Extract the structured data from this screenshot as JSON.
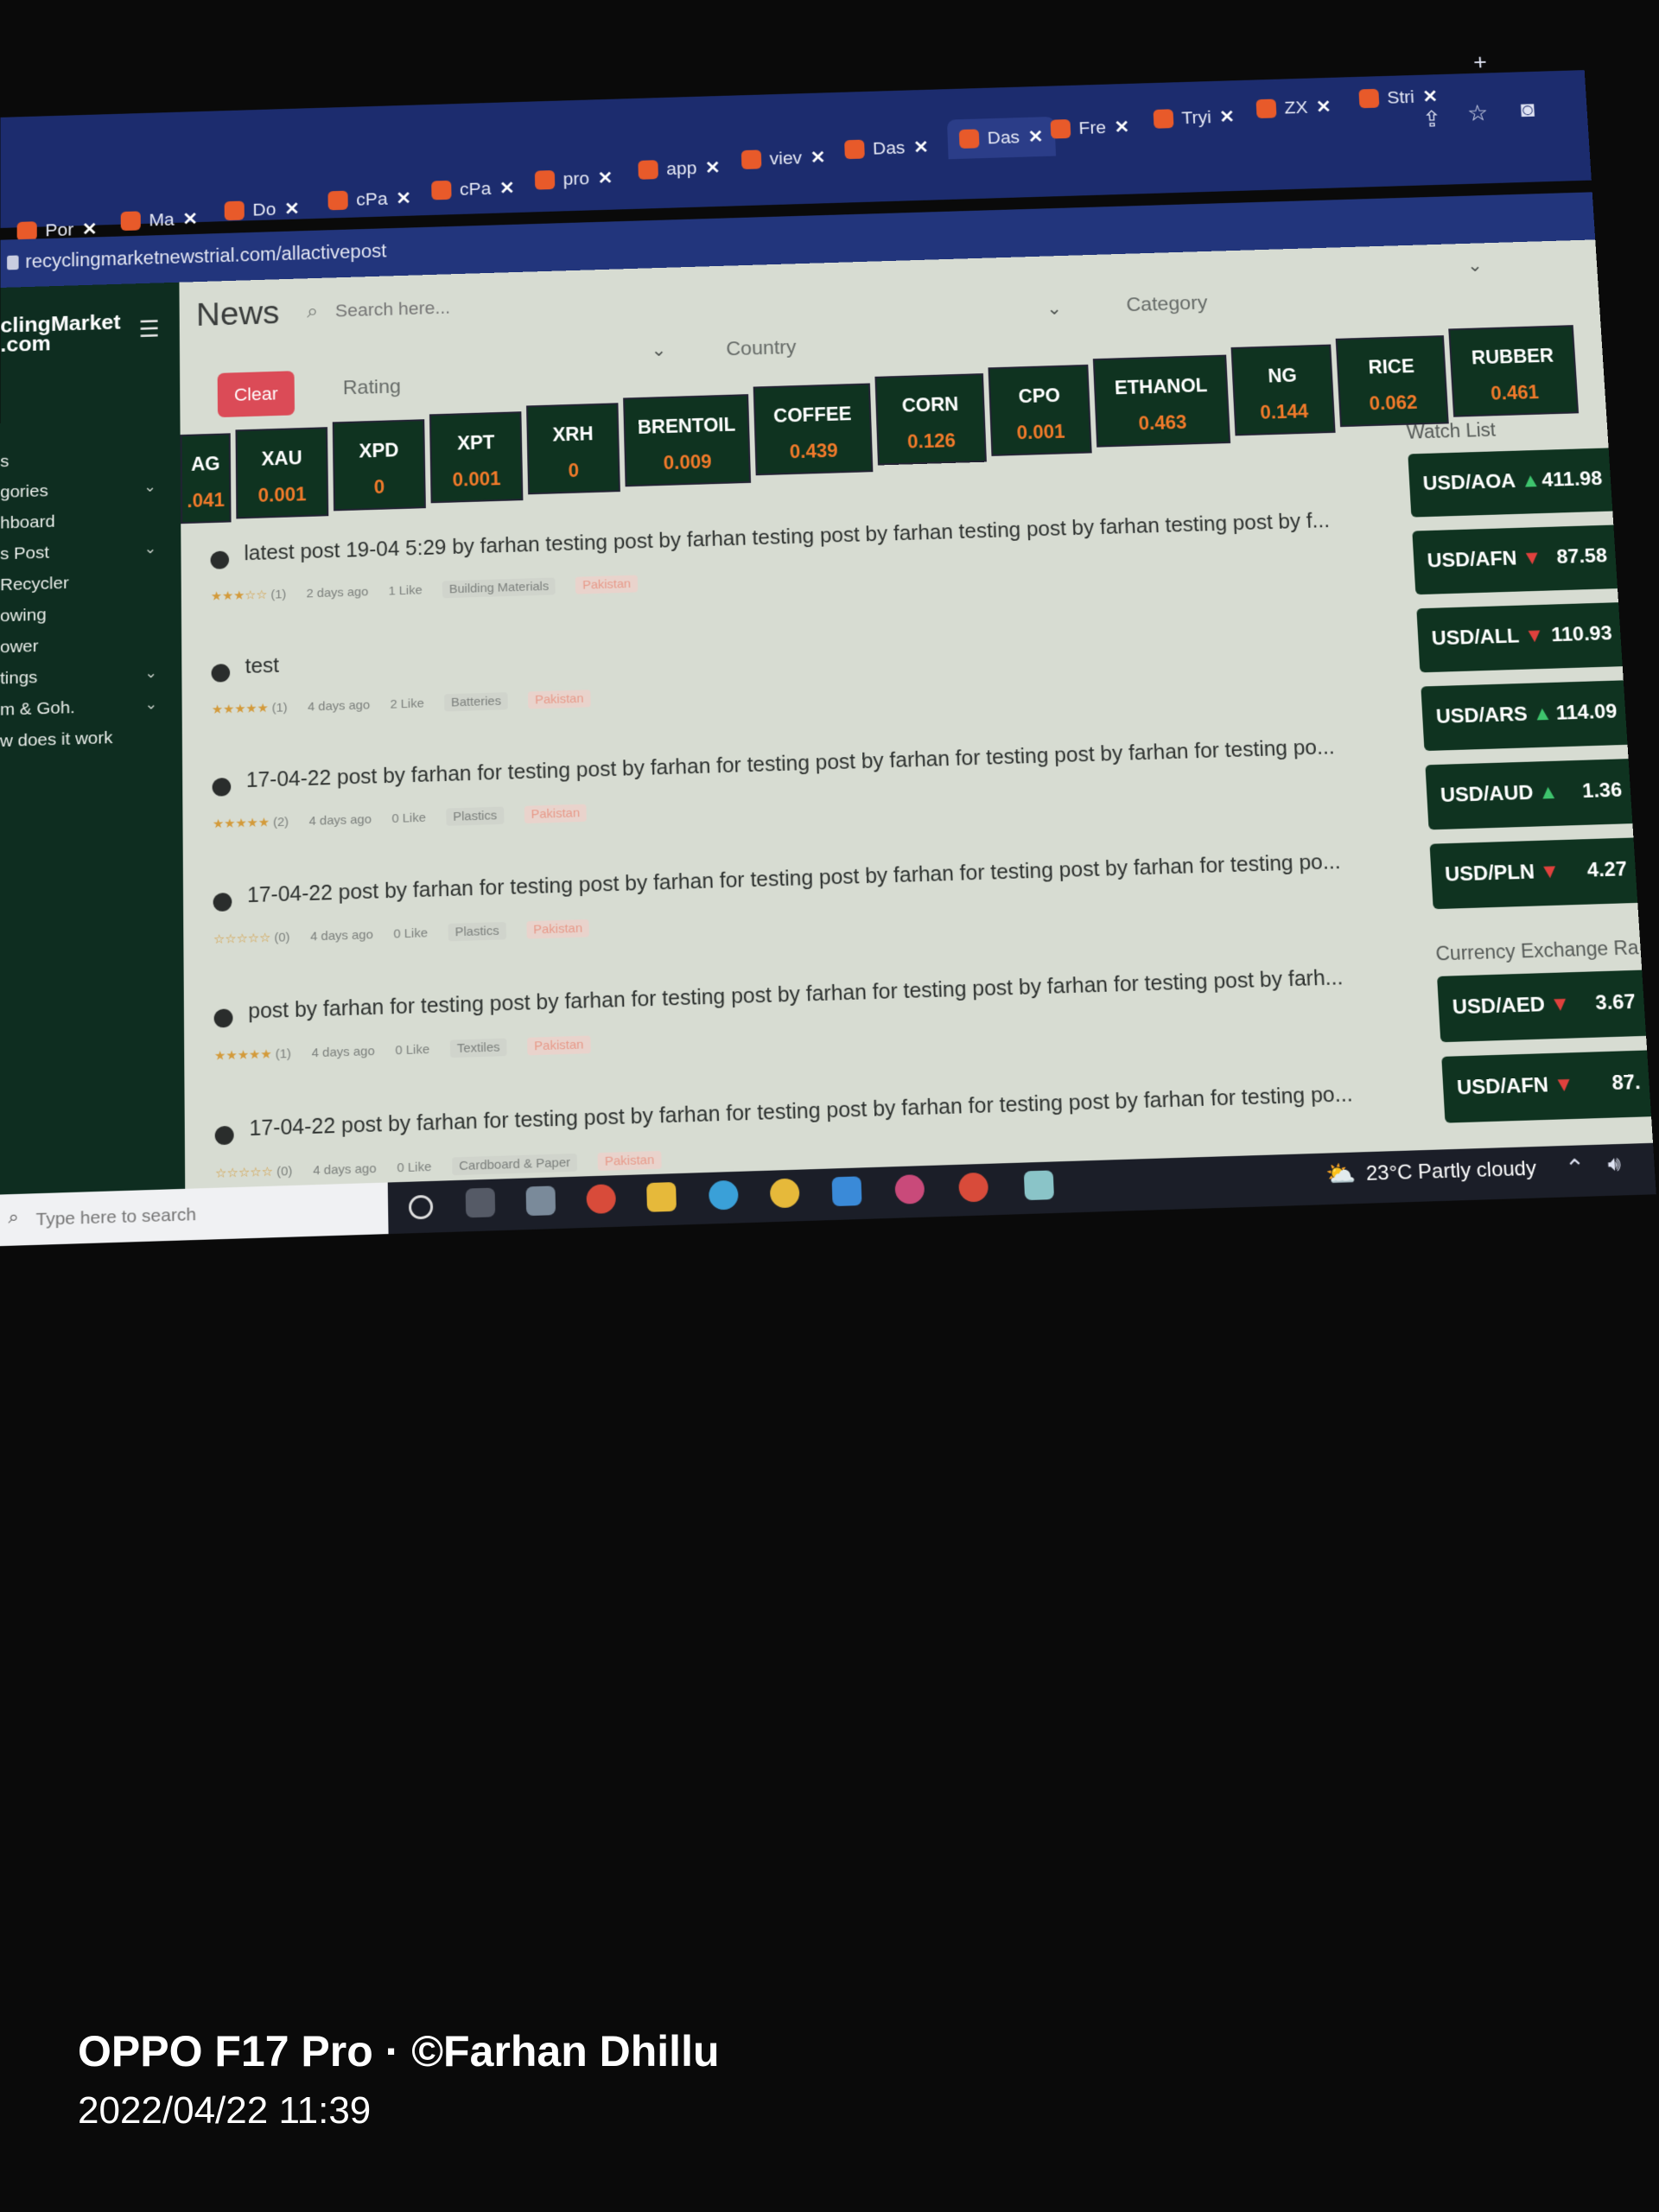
{
  "browser": {
    "tabs": [
      {
        "label": "Por"
      },
      {
        "label": "Ma"
      },
      {
        "label": "Do"
      },
      {
        "label": "cPa"
      },
      {
        "label": "cPa"
      },
      {
        "label": "pro"
      },
      {
        "label": "app"
      },
      {
        "label": "viev"
      },
      {
        "label": "Das"
      },
      {
        "label": "Das",
        "active": true
      },
      {
        "label": "Fre"
      },
      {
        "label": "Tryi"
      },
      {
        "label": "ZX"
      },
      {
        "label": "Stri"
      }
    ],
    "url": "recyclingmarketnewstrial.com/allactivepost",
    "new_tab": "+"
  },
  "brand": {
    "line1": "clingMarket",
    "line2": ".com"
  },
  "sidebar": {
    "items": [
      {
        "label": "s",
        "chevron": ""
      },
      {
        "label": "gories",
        "chevron": "⌄"
      },
      {
        "label": "hboard",
        "chevron": ""
      },
      {
        "label": "s Post",
        "chevron": "⌄"
      },
      {
        "label": "Recycler",
        "chevron": ""
      },
      {
        "label": "owing",
        "chevron": ""
      },
      {
        "label": "ower",
        "chevron": ""
      },
      {
        "label": "tings",
        "chevron": "⌄"
      },
      {
        "label": "m & Goh.",
        "chevron": "⌄"
      },
      {
        "label": "w does it work",
        "chevron": ""
      }
    ]
  },
  "page": {
    "title": "News",
    "search_placeholder": "Search here...",
    "clear": "Clear"
  },
  "filters": {
    "rating": "Rating",
    "country": "Country",
    "category": "Category"
  },
  "ticker": [
    {
      "sym": "AG",
      "val": ".041"
    },
    {
      "sym": "XAU",
      "val": "0.001"
    },
    {
      "sym": "XPD",
      "val": "0"
    },
    {
      "sym": "XPT",
      "val": "0.001"
    },
    {
      "sym": "XRH",
      "val": "0"
    },
    {
      "sym": "BRENTOIL",
      "val": "0.009"
    },
    {
      "sym": "COFFEE",
      "val": "0.439"
    },
    {
      "sym": "CORN",
      "val": "0.126"
    },
    {
      "sym": "CPO",
      "val": "0.001"
    },
    {
      "sym": "ETHANOL",
      "val": "0.463"
    },
    {
      "sym": "NG",
      "val": "0.144"
    },
    {
      "sym": "RICE",
      "val": "0.062"
    },
    {
      "sym": "RUBBER",
      "val": "0.461"
    }
  ],
  "posts": [
    {
      "title": "latest post 19-04 5:29 by farhan testing post by farhan testing post by farhan testing post by farhan testing post by f...",
      "stars": "★★★☆☆",
      "reviews": "(1)",
      "age": "2 days ago",
      "likes": "1 Like",
      "category": "Building Materials",
      "country": "Pakistan"
    },
    {
      "title": "test",
      "stars": "★★★★★",
      "reviews": "(1)",
      "age": "4 days ago",
      "likes": "2 Like",
      "category": "Batteries",
      "country": "Pakistan"
    },
    {
      "title": "17-04-22 post by farhan for testing post by farhan for testing post by farhan for testing post by farhan for testing po...",
      "stars": "★★★★★",
      "reviews": "(2)",
      "age": "4 days ago",
      "likes": "0 Like",
      "category": "Plastics",
      "country": "Pakistan"
    },
    {
      "title": "17-04-22 post by farhan for testing post by farhan for testing post by farhan for testing post by farhan for testing po...",
      "stars": "☆☆☆☆☆",
      "reviews": "(0)",
      "age": "4 days ago",
      "likes": "0 Like",
      "category": "Plastics",
      "country": "Pakistan"
    },
    {
      "title": "post by farhan for testing post by farhan for testing post by farhan for testing post by farhan for testing post by farh...",
      "stars": "★★★★★",
      "reviews": "(1)",
      "age": "4 days ago",
      "likes": "0 Like",
      "category": "Textiles",
      "country": "Pakistan"
    },
    {
      "title": "17-04-22 post by farhan for testing post by farhan for testing post by farhan for testing post by farhan for testing po...",
      "stars": "☆☆☆☆☆",
      "reviews": "(0)",
      "age": "4 days ago",
      "likes": "0 Like",
      "category": "Cardboard & Paper",
      "country": "Pakistan"
    }
  ],
  "watch_list": {
    "title": "Watch List",
    "rows": [
      {
        "pair": "USD/AOA",
        "dir": "up",
        "arrow": "▲",
        "value": "411.98"
      },
      {
        "pair": "USD/AFN",
        "dir": "down",
        "arrow": "▼",
        "value": "87.58"
      },
      {
        "pair": "USD/ALL",
        "dir": "down",
        "arrow": "▼",
        "value": "110.93"
      },
      {
        "pair": "USD/ARS",
        "dir": "up",
        "arrow": "▲",
        "value": "114.09"
      },
      {
        "pair": "USD/AUD",
        "dir": "up",
        "arrow": "▲",
        "value": "1.36"
      },
      {
        "pair": "USD/PLN",
        "dir": "down",
        "arrow": "▼",
        "value": "4.27"
      }
    ]
  },
  "exchange_rates": {
    "title": "Currency Exchange Ra",
    "rows": [
      {
        "pair": "USD/AED",
        "dir": "down",
        "arrow": "▼",
        "value": "3.67"
      },
      {
        "pair": "USD/AFN",
        "dir": "down",
        "arrow": "▼",
        "value": "87."
      }
    ]
  },
  "taskbar": {
    "search_placeholder": "Type here to search",
    "weather": "23°C  Partly cloudy"
  },
  "photo_watermark": {
    "model": "OPPO F17 Pro · ©Farhan Dhillu",
    "date": "2022/04/22 11:39"
  },
  "colors": {
    "sidebar": "#0e2d20",
    "ticker_bg": "#0f3320",
    "ticker_value": "#f07a2a",
    "clear_button": "#db4b57",
    "up": "#3ec46d",
    "down": "#e0413d"
  }
}
